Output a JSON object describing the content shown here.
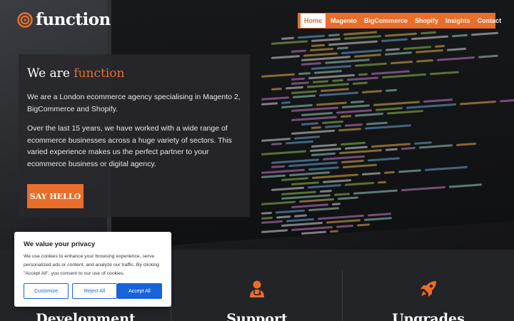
{
  "brand": {
    "name": "function",
    "accent_color": "#ea6d2a",
    "logo_icon": "concentric-circles-icon"
  },
  "nav": {
    "items": [
      {
        "label": "Home",
        "active": true
      },
      {
        "label": "Magento",
        "active": false
      },
      {
        "label": "BigCommerce",
        "active": false
      },
      {
        "label": "Shopify",
        "active": false
      },
      {
        "label": "Insights",
        "active": false
      },
      {
        "label": "Contact",
        "active": false
      }
    ]
  },
  "hero": {
    "heading_prefix": "We are",
    "heading_accent": "function",
    "paragraph_1": "We are a London ecommerce agency specialising in Magento 2, BigCommerce and Shopify.",
    "paragraph_2": "Over the last 15 years, we have worked with a wide range of ecommerce businesses across a huge variety of sectors. This varied experience makes us the perfect partner to your ecommerce business or digital agency.",
    "cta_label": "SAY HELLO"
  },
  "services": [
    {
      "title": "Development",
      "icon": "code-icon"
    },
    {
      "title": "Support",
      "icon": "support-doctor-icon"
    },
    {
      "title": "Upgrades",
      "icon": "rocket-icon"
    }
  ],
  "cookie_banner": {
    "title": "We value your privacy",
    "text": "We use cookies to enhance your browsing experience, serve personalized ads or content, and analyze our traffic. By clicking \"Accept All\", you consent to our use of cookies.",
    "customize_label": "Customize",
    "reject_label": "Reject All",
    "accept_label": "Accept All",
    "button_color": "#1863dc"
  }
}
